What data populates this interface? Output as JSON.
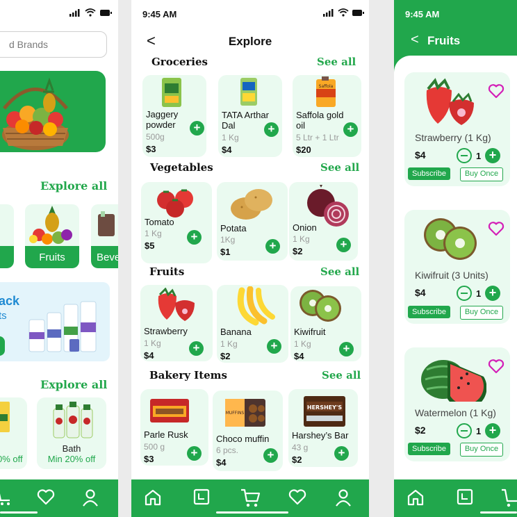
{
  "left_screen": {
    "search_placeholder": "d Brands",
    "explore_all_1": "Explore all",
    "categories": [
      {
        "label": "ble"
      },
      {
        "label": "Fruits"
      },
      {
        "label": "Beve"
      }
    ],
    "promo": {
      "title": "ack",
      "subtitle": "ts"
    },
    "explore_all_2": "Explore all",
    "bottom_cards": [
      {
        "title": "",
        "discount": "0% off"
      },
      {
        "title": "Bath",
        "discount": "Min 20% off"
      }
    ]
  },
  "middle_screen": {
    "time": "9:45 AM",
    "back": "<",
    "title": "Explore",
    "sections": [
      {
        "title": "Groceries",
        "see_all": "See all",
        "items": [
          {
            "name": "Jaggery powder",
            "qty": "500g",
            "price": "$3"
          },
          {
            "name": "TATA Arthar Dal",
            "qty": "1 Kg",
            "price": "$4"
          },
          {
            "name": "Saffola gold oil",
            "qty": "5 Ltr + 1 Ltr",
            "price": "$20"
          }
        ]
      },
      {
        "title": "Vegetables",
        "see_all": "See all",
        "items": [
          {
            "name": "Tomato",
            "qty": "1 Kg",
            "price": "$5"
          },
          {
            "name": "Potata",
            "qty": "1Kg",
            "price": "$1"
          },
          {
            "name": "Onion",
            "qty": "1 Kg",
            "price": "$2"
          }
        ]
      },
      {
        "title": "Fruits",
        "see_all": "See all",
        "items": [
          {
            "name": "Strawberry",
            "qty": "1 Kg",
            "price": "$4"
          },
          {
            "name": "Banana",
            "qty": "1 Kg",
            "price": "$2"
          },
          {
            "name": "Kiwifruit",
            "qty": "1 Kg",
            "price": "$4"
          }
        ]
      },
      {
        "title": "Bakery Items",
        "see_all": "See all",
        "items": [
          {
            "name": "Parle Rusk",
            "qty": "500 g",
            "price": "$3"
          },
          {
            "name": "Choco muffin",
            "qty": "6 pcs.",
            "price": "$4"
          },
          {
            "name": "Harshey’s Bar",
            "qty": "43 g",
            "price": "$2"
          }
        ]
      }
    ],
    "add_symbol": "+",
    "packaging_text": {
      "saffola": "Saffola",
      "hersheys": "HERSHEY'S",
      "muffins": "MUFFINS"
    }
  },
  "right_screen": {
    "time": "9:45 AM",
    "back": "<",
    "title": "Fruits",
    "products": [
      {
        "name": "Strawberry (1 Kg)",
        "price": "$4",
        "qty": "1"
      },
      {
        "name": "Kiwifruit (3 Units)",
        "price": "$4",
        "qty": "1"
      },
      {
        "name": "Watermelon (1 Kg)",
        "price": "$2",
        "qty": "1"
      }
    ],
    "subscribe_label": "Subscribe",
    "buy_once_label": "Buy Once",
    "plus": "+"
  },
  "colors": {
    "primary": "#21a74c",
    "card_bg": "#eafaf0",
    "heart": "#d31fb7",
    "promo_blue": "#1f8ad2"
  },
  "icons": [
    "signal-icon",
    "wifi-icon",
    "battery-icon",
    "home-icon",
    "orders-icon",
    "cart-icon",
    "heart-icon",
    "user-icon",
    "search-icon"
  ]
}
